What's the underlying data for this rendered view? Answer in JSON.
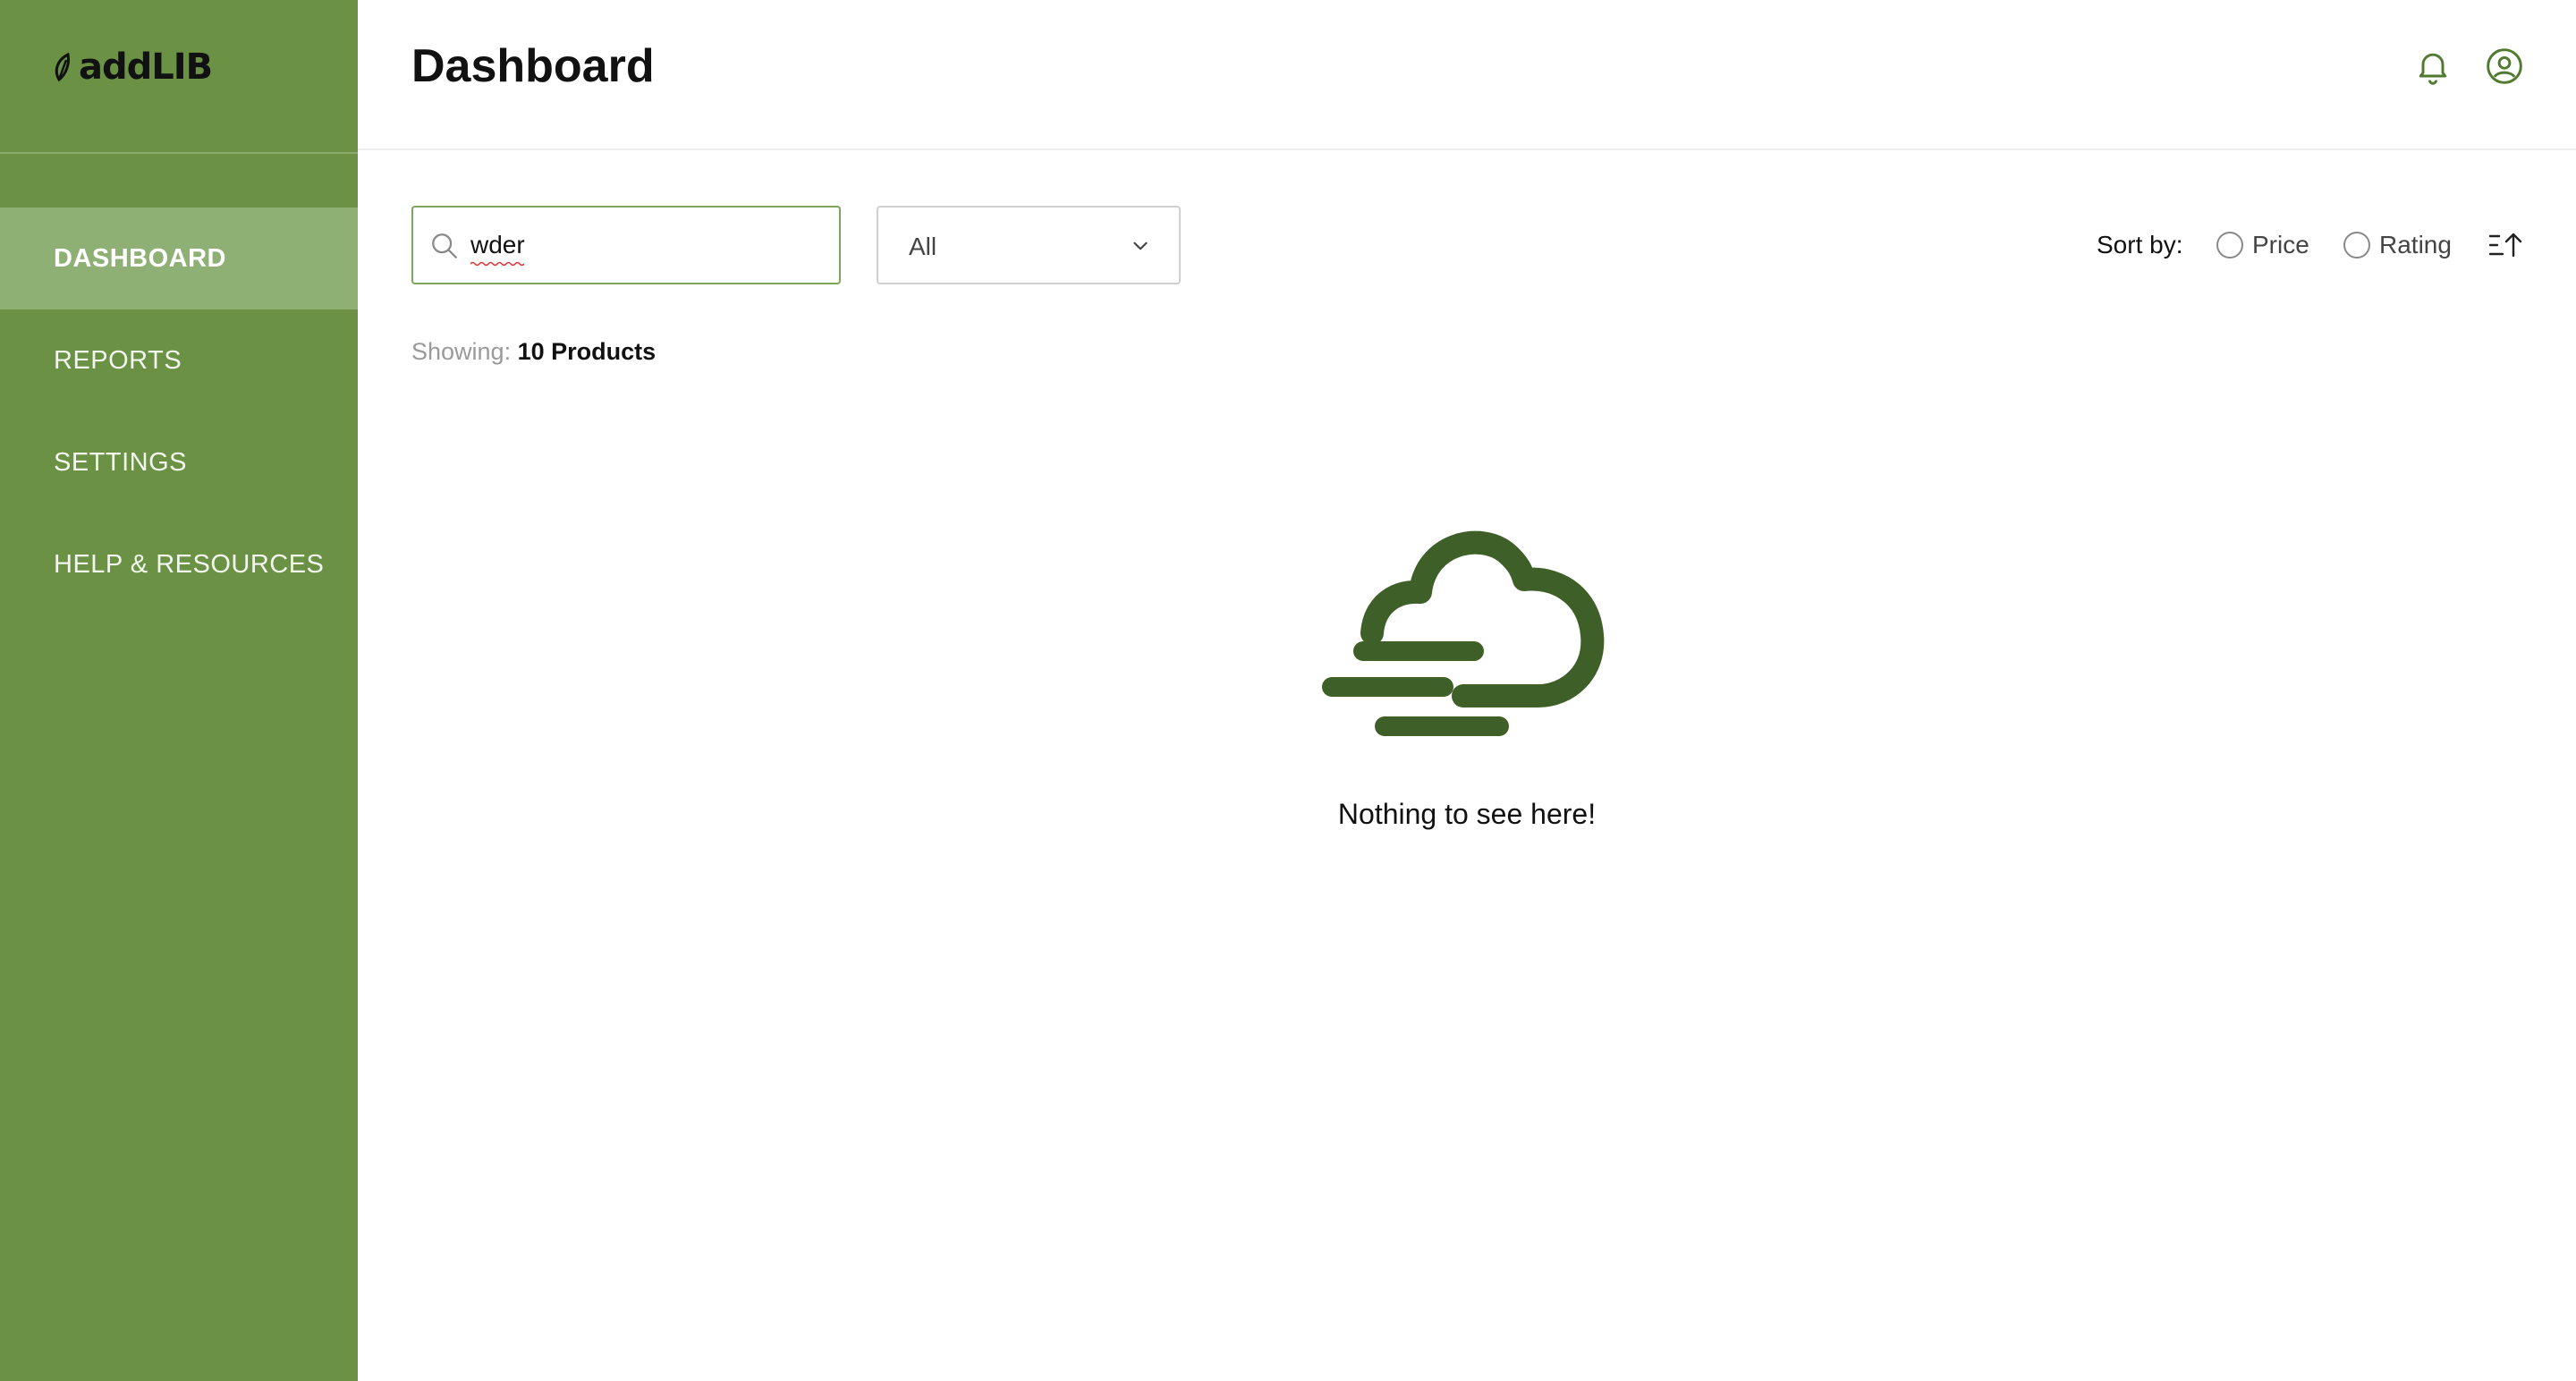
{
  "app": {
    "logo_text": "addLIB"
  },
  "sidebar": {
    "items": [
      {
        "label": "DASHBOARD",
        "active": true
      },
      {
        "label": "REPORTS",
        "active": false
      },
      {
        "label": "SETTINGS",
        "active": false
      },
      {
        "label": "HELP & RESOURCES",
        "active": false
      }
    ]
  },
  "header": {
    "title": "Dashboard",
    "icons": [
      "bell-icon",
      "user-circle-icon"
    ]
  },
  "toolbar": {
    "search": {
      "value": "wder",
      "placeholder": ""
    },
    "category_filter": {
      "selected": "All"
    },
    "sort": {
      "label": "Sort by:",
      "options": [
        "Price",
        "Rating"
      ],
      "direction_icon": "sort-ascending-icon"
    }
  },
  "results": {
    "showing_label": "Showing:",
    "showing_count": "10 Products"
  },
  "empty_state": {
    "icon": "cloud-icon",
    "message": "Nothing to see here!"
  },
  "colors": {
    "sidebar": "#6b9145",
    "sidebar_active": "#8fb075",
    "accent": "#3f5f28",
    "search_border": "#7ea45a"
  }
}
